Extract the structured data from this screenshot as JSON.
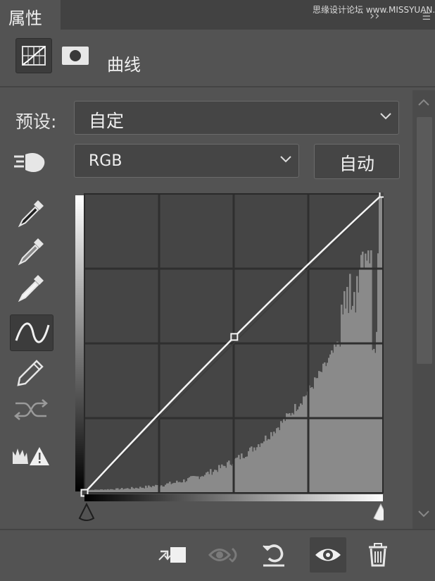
{
  "tabs": {
    "active_label": "属性",
    "watermark": "思缘设计论坛 www.MISSYUAN.COM"
  },
  "header": {
    "title": "曲线",
    "icons": [
      "curves-adjustment-icon",
      "mask-icon"
    ]
  },
  "preset": {
    "label": "预设:",
    "value": "自定"
  },
  "channel": {
    "value": "RGB"
  },
  "auto_button": {
    "label": "自动"
  },
  "tools": [
    "on-image-adjust-icon",
    "black-point-eyedropper-icon",
    "gray-point-eyedropper-icon",
    "white-point-eyedropper-icon",
    "curve-edit-points-icon",
    "pencil-draw-icon",
    "smooth-curve-icon",
    "clipping-warning-icon"
  ],
  "curve_points": [
    [
      0,
      0
    ],
    [
      128,
      133
    ],
    [
      255,
      255
    ]
  ],
  "colors": {
    "panel_bg": "#535353",
    "graph_bg": "#454545",
    "histogram": "#8a8a8a",
    "curve": "#f5f5f5"
  },
  "footer_icons": [
    "clip-to-layer-icon",
    "view-previous-state-icon",
    "reset-icon",
    "visibility-eye-icon",
    "delete-icon"
  ]
}
